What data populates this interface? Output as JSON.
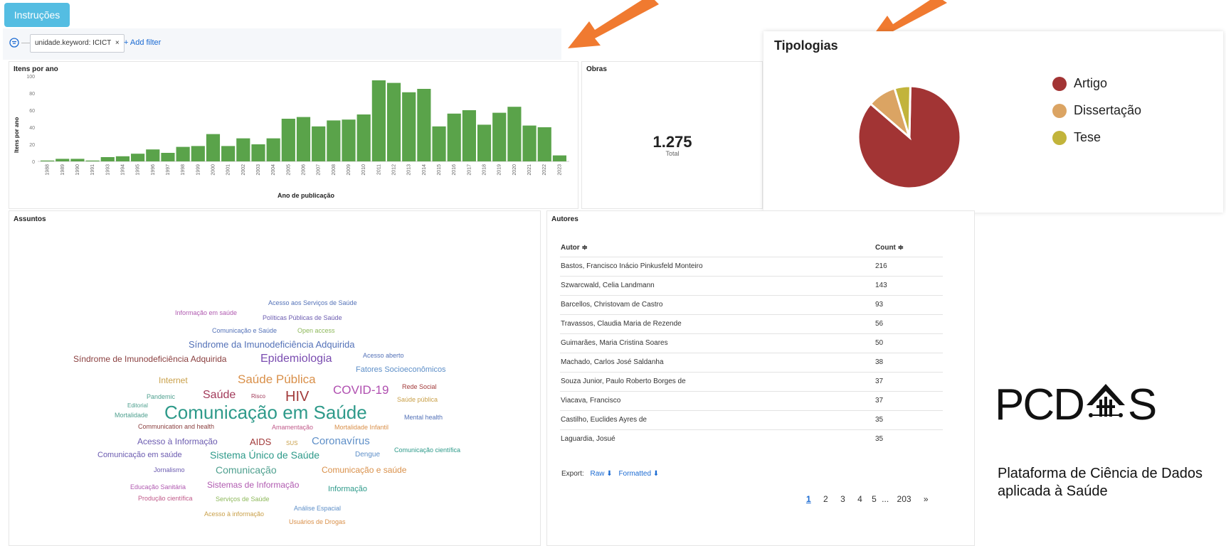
{
  "instructions_button": "Instruções",
  "filter": {
    "pill_label": "unidade.keyword: ICICT",
    "pill_close": "×",
    "add_filter": "+ Add filter"
  },
  "itens_por_ano": {
    "title": "Itens por ano",
    "ylabel": "Itens por ano",
    "xlabel": "Ano de publicação",
    "yticks": [
      "100",
      "80",
      "60",
      "40",
      "20",
      "0"
    ]
  },
  "chart_data": {
    "type": "bar",
    "title": "Itens por ano",
    "xlabel": "Ano de publicação",
    "ylabel": "Itens por ano",
    "ylim": [
      0,
      100
    ],
    "categories": [
      "1988",
      "1989",
      "1990",
      "1991",
      "1993",
      "1994",
      "1995",
      "1996",
      "1997",
      "1998",
      "1999",
      "2000",
      "2001",
      "2002",
      "2003",
      "2004",
      "2005",
      "2006",
      "2007",
      "2008",
      "2009",
      "2010",
      "2011",
      "2012",
      "2013",
      "2014",
      "2015",
      "2016",
      "2017",
      "2018",
      "2019",
      "2020",
      "2021",
      "2022",
      "2023"
    ],
    "values": [
      1,
      3,
      3,
      1,
      5,
      6,
      9,
      14,
      10,
      17,
      18,
      32,
      18,
      27,
      20,
      27,
      50,
      52,
      41,
      48,
      49,
      55,
      95,
      92,
      81,
      85,
      41,
      56,
      60,
      43,
      57,
      64,
      42,
      40,
      7
    ],
    "color": "#5aa34a"
  },
  "obras": {
    "title": "Obras",
    "value": "1.275",
    "sub": "Total"
  },
  "tipologias": {
    "title": "Tipologias",
    "legend": [
      {
        "label": "Artigo",
        "color": "#a23434",
        "value": 86
      },
      {
        "label": "Dissertação",
        "color": "#dba463",
        "value": 9
      },
      {
        "label": "Tese",
        "color": "#c2b43b",
        "value": 5
      }
    ]
  },
  "assuntos": {
    "title": "Assuntos",
    "words": [
      {
        "text": "Acesso aos Serviços de Saúde",
        "color": "#5472b8"
      },
      {
        "text": "Informação em saúde",
        "color": "#b05ab0"
      },
      {
        "text": "Políticas Públicas de Saúde",
        "color": "#6b5bb0"
      },
      {
        "text": "Comunicação e Saúde",
        "color": "#5472b8"
      },
      {
        "text": "Open access",
        "color": "#8db85a"
      },
      {
        "text": "Síndrome da Imunodeficiência Adquirida",
        "color": "#5472b8"
      },
      {
        "text": "Síndrome de Imunodeficiência Adquirida",
        "color": "#8a3f3f"
      },
      {
        "text": "Epidemiologia",
        "color": "#7a4cb0"
      },
      {
        "text": "Acesso aberto",
        "color": "#5472b8"
      },
      {
        "text": "Fatores Socioeconômicos",
        "color": "#5e8fc8"
      },
      {
        "text": "Internet",
        "color": "#c9a04a"
      },
      {
        "text": "Saúde Pública",
        "color": "#d9904a"
      },
      {
        "text": "Saúde",
        "color": "#a23a5a"
      },
      {
        "text": "Risco",
        "color": "#a23a5a"
      },
      {
        "text": "HIV",
        "color": "#a23a3a"
      },
      {
        "text": "COVID-19",
        "color": "#b04fb0"
      },
      {
        "text": "Rede Social",
        "color": "#a23a3a"
      },
      {
        "text": "Pandemic",
        "color": "#4fa08f"
      },
      {
        "text": "Saúde pública",
        "color": "#c9a04a"
      },
      {
        "text": "Editorial",
        "color": "#4fa08f"
      },
      {
        "text": "Comunicação em Saúde",
        "color": "#2e9a8a"
      },
      {
        "text": "Mortalidade",
        "color": "#4fa08f"
      },
      {
        "text": "Mental health",
        "color": "#5472b8"
      },
      {
        "text": "Communication and health",
        "color": "#8a3f3f"
      },
      {
        "text": "Amamentação",
        "color": "#c05a8a"
      },
      {
        "text": "Mortalidade Infantil",
        "color": "#d9904a"
      },
      {
        "text": "Acesso à Informação",
        "color": "#6b5bb0"
      },
      {
        "text": "AIDS",
        "color": "#a23a3a"
      },
      {
        "text": "SUS",
        "color": "#c9a04a"
      },
      {
        "text": "Coronavírus",
        "color": "#5e8fc8"
      },
      {
        "text": "Comunicação em saúde",
        "color": "#6b5bb0"
      },
      {
        "text": "Sistema Único de Saúde",
        "color": "#2e9a8a"
      },
      {
        "text": "Dengue",
        "color": "#5e8fc8"
      },
      {
        "text": "Comunicação científica",
        "color": "#2e9a8a"
      },
      {
        "text": "Jornalismo",
        "color": "#6b5bb0"
      },
      {
        "text": "Comunicação",
        "color": "#4fa08f"
      },
      {
        "text": "Comunicação e saúde",
        "color": "#d9904a"
      },
      {
        "text": "Educação Sanitária",
        "color": "#b05ab0"
      },
      {
        "text": "Sistemas de Informação",
        "color": "#b05ab0"
      },
      {
        "text": "Informação",
        "color": "#2e9a8a"
      },
      {
        "text": "Produção científica",
        "color": "#c05a8a"
      },
      {
        "text": "Serviços de Saúde",
        "color": "#8db85a"
      },
      {
        "text": "Análise Espacial",
        "color": "#5e8fc8"
      },
      {
        "text": "Acesso à informação",
        "color": "#c9a04a"
      },
      {
        "text": "Usuários de Drogas",
        "color": "#d9904a"
      }
    ]
  },
  "autores": {
    "title": "Autores",
    "col_autor": "Autor ≑",
    "col_count": "Count ≑",
    "rows": [
      {
        "autor": "Bastos, Francisco Inácio Pinkusfeld Monteiro",
        "count": "216"
      },
      {
        "autor": "Szwarcwald, Celia Landmann",
        "count": "143"
      },
      {
        "autor": "Barcellos, Christovam de Castro",
        "count": "93"
      },
      {
        "autor": "Travassos, Claudia Maria de Rezende",
        "count": "56"
      },
      {
        "autor": "Guimarães, Maria Cristina Soares",
        "count": "50"
      },
      {
        "autor": "Machado, Carlos José Saldanha",
        "count": "38"
      },
      {
        "autor": "Souza Junior, Paulo Roberto Borges de",
        "count": "37"
      },
      {
        "autor": "Viacava, Francisco",
        "count": "37"
      },
      {
        "autor": "Castilho, Euclides Ayres de",
        "count": "35"
      },
      {
        "autor": "Laguardia, Josué",
        "count": "35"
      }
    ],
    "export_label": "Export:",
    "export_raw": "Raw",
    "export_formatted": "Formatted",
    "pages": [
      "1",
      "2",
      "3",
      "4",
      "5",
      "...",
      "203",
      "»"
    ]
  },
  "brand": {
    "logo_left": "PCD",
    "logo_right": "S",
    "subtitle_line1": "Plataforma de Ciência de Dados",
    "subtitle_line2": "aplicada à Saúde",
    "arrow_color": "#f07a30"
  }
}
